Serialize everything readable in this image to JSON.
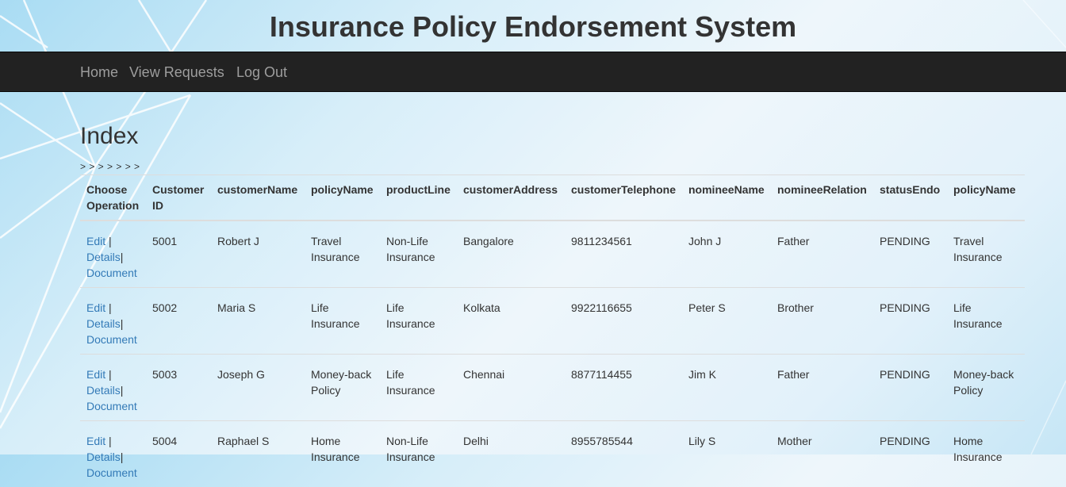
{
  "header": {
    "title": "Insurance Policy Endorsement System"
  },
  "nav": [
    {
      "label": "Home"
    },
    {
      "label": "View Requests"
    },
    {
      "label": "Log Out"
    }
  ],
  "main": {
    "heading": "Index",
    "arrows": "> > > > > > >",
    "table": {
      "headers": {
        "op1": "Choose",
        "op2": "Operation",
        "id1": "Customer",
        "id2": "ID",
        "customerName": "customerName",
        "policyName": "policyName",
        "productLine": "productLine",
        "customerAddress": "customerAddress",
        "customerTelephone": "customerTelephone",
        "nomineeName": "nomineeName",
        "nomineeRelation": "nomineeRelation",
        "statusEndo": "statusEndo",
        "policyName2": "policyName"
      },
      "operations": {
        "edit": "Edit",
        "sep1": " |",
        "details": "Details",
        "sep2": "|",
        "document": "Document"
      },
      "rows": [
        {
          "id": "5001",
          "name": "Robert J",
          "policy1": "Travel",
          "policy2": "Insurance",
          "line1": "Non-Life",
          "line2": "Insurance",
          "address": "Bangalore",
          "phone": "9811234561",
          "nominee": "John J",
          "relation": "Father",
          "status": "PENDING"
        },
        {
          "id": "5002",
          "name": "Maria S",
          "policy1": "Life",
          "policy2": "Insurance",
          "line1": "Life",
          "line2": "Insurance",
          "address": "Kolkata",
          "phone": "9922116655",
          "nominee": "Peter S",
          "relation": "Brother",
          "status": "PENDING"
        },
        {
          "id": "5003",
          "name": "Joseph G",
          "policy1": "Money-back",
          "policy2": "Policy",
          "line1": "Life",
          "line2": "Insurance",
          "address": "Chennai",
          "phone": "8877114455",
          "nominee": "Jim K",
          "relation": "Father",
          "status": "PENDING"
        },
        {
          "id": "5004",
          "name": "Raphael S",
          "policy1": "Home",
          "policy2": "Insurance",
          "line1": "Non-Life",
          "line2": "Insurance",
          "address": "Delhi",
          "phone": "8955785544",
          "nominee": "Lily S",
          "relation": "Mother",
          "status": "PENDING"
        }
      ]
    }
  }
}
